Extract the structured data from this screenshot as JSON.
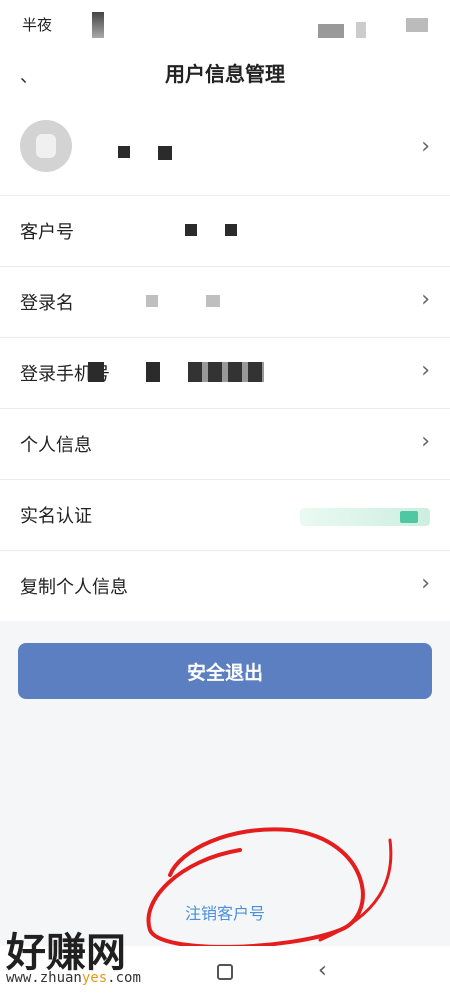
{
  "status_bar": {
    "time": "半夜"
  },
  "header": {
    "back_icon": "back-icon",
    "title": "用户信息管理"
  },
  "rows": {
    "customer_no": {
      "label": "客户号"
    },
    "login_name": {
      "label": "登录名"
    },
    "login_phone": {
      "label": "登录手机号"
    },
    "personal_info": {
      "label": "个人信息"
    },
    "realname": {
      "label": "实名认证"
    },
    "copy_info": {
      "label": "复制个人信息"
    }
  },
  "logout": {
    "label": "安全退出"
  },
  "cancel_account": {
    "label": "注销客户号"
  },
  "watermark": {
    "brand": "好赚网",
    "url_prefix": "www.zhuan",
    "url_highlight": "yes",
    "url_suffix": ".com"
  },
  "colors": {
    "accent": "#5b7fc1",
    "link": "#4a90d9",
    "scribble": "#e41d1d"
  }
}
